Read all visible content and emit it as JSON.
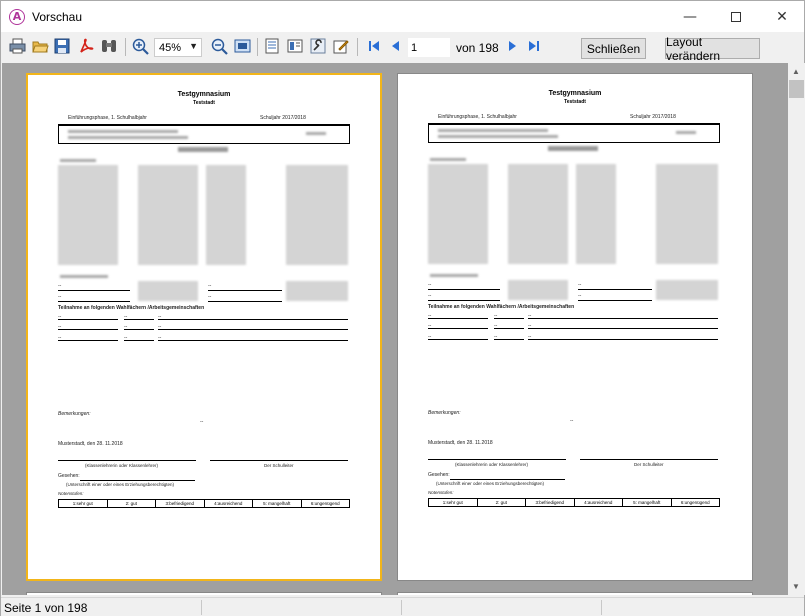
{
  "window": {
    "title": "Vorschau",
    "app_icon_letter": "A"
  },
  "toolbar": {
    "zoom": "45%",
    "page_number": "1",
    "page_of": "von 198",
    "close_label": "Schließen",
    "layout_label": "Layout verändern"
  },
  "status": {
    "text": "Seite 1 von 198"
  },
  "document": {
    "school": "Testgymnasium",
    "city": "Teststadt",
    "phase": "Einführungsphase, 1. Schulhalbjahr",
    "school_year": "Schuljahr 2017/2018",
    "heading": "Zeugnis",
    "ag_heading": "Teilnahme an folgenden Wahlfächern /Arbeitsgemeinschaften",
    "remarks_label": "Bemerkungen:",
    "place_date": "Musterstadt, den 28. 11.2018",
    "teacher_label": "(Klassenlehrerin oder Klassenlehrer)",
    "principal_label": "Der Schulleiter",
    "seen_label": "Gesehen:",
    "guardian_label": "(Unterschrift einer oder eines Erziehungsberechtigten)",
    "grades_label": "Notenstufen:",
    "grades": [
      "1:sehr gut",
      "2: gut",
      "3:befriedigend",
      "4:ausreichend",
      "5: mangelhaft",
      "6:ungenügend"
    ],
    "dash": "--"
  }
}
